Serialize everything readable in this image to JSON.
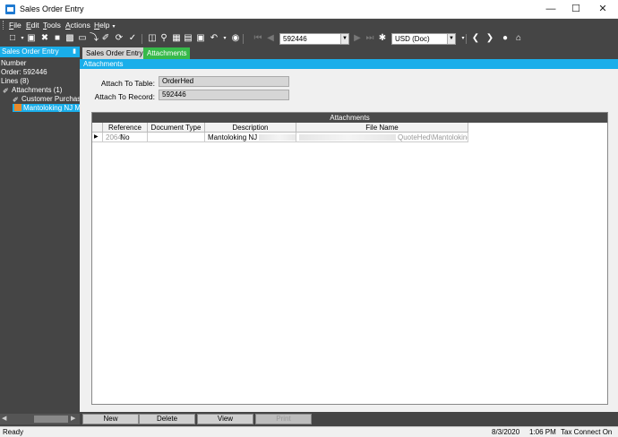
{
  "window": {
    "title": "Sales Order Entry"
  },
  "menu": [
    {
      "key": "F",
      "rest": "ile"
    },
    {
      "key": "E",
      "rest": "dit"
    },
    {
      "key": "T",
      "rest": "ools"
    },
    {
      "key": "A",
      "rest": "ctions"
    },
    {
      "key": "H",
      "rest": "elp"
    }
  ],
  "toolbar": {
    "record_combo_value": "592446",
    "currency_combo_value": "USD (Doc)"
  },
  "tree": {
    "header": "Sales Order Entry",
    "nodes": [
      "Number",
      "Order: 592446",
      "Lines (8)",
      "Attachments (1)",
      "Customer Purchas",
      "Mantoloking NJ M"
    ]
  },
  "tabs": [
    "Sales Order Entry",
    "Attachments"
  ],
  "panel": {
    "header": "Attachments",
    "attach_table_label": "Attach To Table:",
    "attach_table_value": "OrderHed",
    "attach_record_label": "Attach To Record:",
    "attach_record_value": "592446"
  },
  "grid": {
    "title": "Attachments",
    "columns": [
      "Reference No",
      "Document Type",
      "Description",
      "File Name"
    ],
    "rows": [
      {
        "ref": "20640",
        "doctype": "",
        "description": "Mantoloking NJ",
        "filename": "QuoteHed\\Mantoloking"
      }
    ]
  },
  "buttons": {
    "new": "New",
    "delete": "Delete",
    "view": "View",
    "print": "Print"
  },
  "status": {
    "left": "Ready",
    "date": "8/3/2020",
    "time": "1:06 PM",
    "tax": "Tax Connect On"
  }
}
